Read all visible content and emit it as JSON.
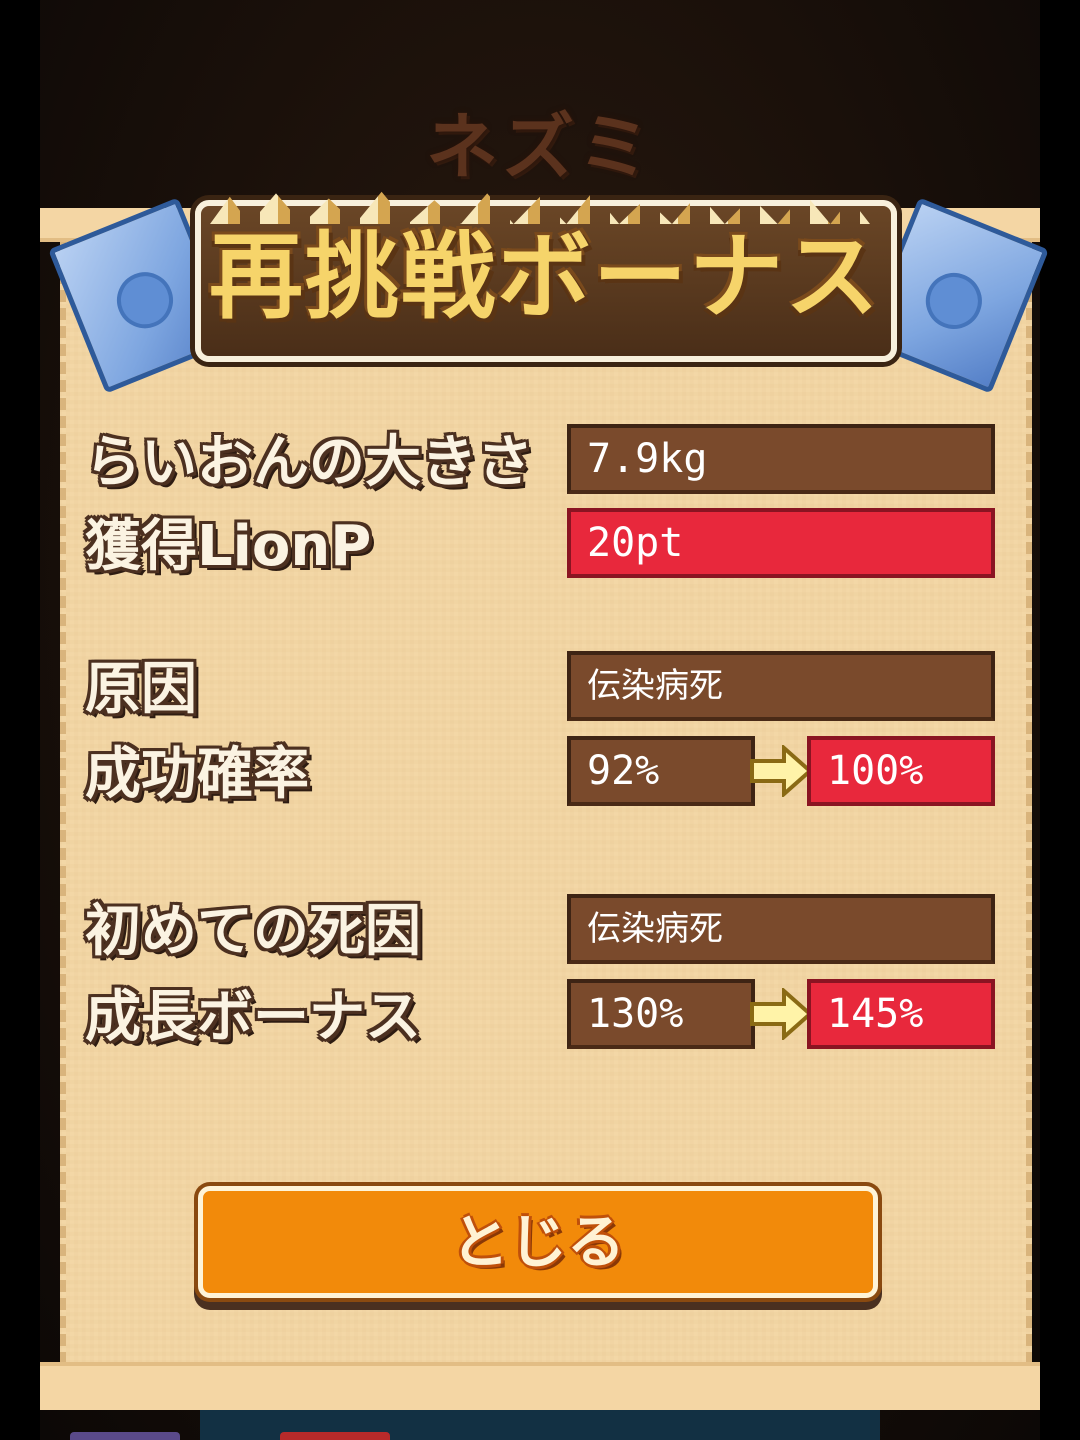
{
  "background_title": "ネズミ",
  "banner": {
    "title": "再挑戦ボーナス"
  },
  "stats": {
    "size_label": "らいおんの大きさ",
    "size_value": "7.9kg",
    "lionp_label": "獲得LionP",
    "lionp_value": "20pt",
    "cause_label": "原因",
    "cause_value": "伝染病死",
    "success_label": "成功確率",
    "success_before": "92%",
    "success_after": "100%",
    "first_death_label": "初めての死因",
    "first_death_value": "伝染病死",
    "growth_label": "成長ボーナス",
    "growth_before": "130%",
    "growth_after": "145%"
  },
  "close_button": {
    "label": "とじる"
  },
  "colors": {
    "panel": "#f3d7a6",
    "value_brown": "#7a4a2c",
    "value_red": "#e8283c",
    "button_orange": "#f28a0a",
    "banner_text": "#f6d46a",
    "book_blue": "#7ea6e0"
  },
  "icons": [
    "book-left-icon",
    "book-right-icon",
    "arrow-right-icon",
    "arrow-right-icon"
  ]
}
